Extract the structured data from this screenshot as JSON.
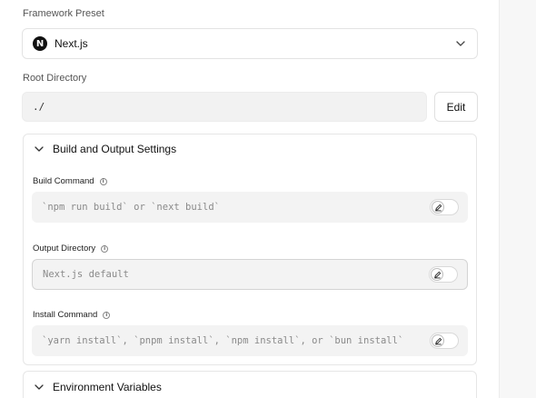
{
  "framework_preset": {
    "label": "Framework Preset",
    "logo_letter": "N",
    "value": "Next.js",
    "icon": "chevron-down-icon"
  },
  "root_directory": {
    "label": "Root Directory",
    "value": "./",
    "edit_label": "Edit"
  },
  "build_settings": {
    "title": "Build and Output Settings",
    "expanded": true,
    "fields": [
      {
        "label": "Build Command",
        "placeholder": "`npm run build` or `next build`",
        "override": false
      },
      {
        "label": "Output Directory",
        "placeholder": "Next.js default",
        "override": false
      },
      {
        "label": "Install Command",
        "placeholder": "`yarn install`, `pnpm install`, `npm install`, or `bun install`",
        "override": false
      }
    ]
  },
  "environment_variables": {
    "title": "Environment Variables",
    "expanded": false
  },
  "colors": {
    "accent": "#111111",
    "field_bg": "#f3f3f3",
    "border": "#e6e6e6",
    "right_pane": "#f7f7f7"
  }
}
